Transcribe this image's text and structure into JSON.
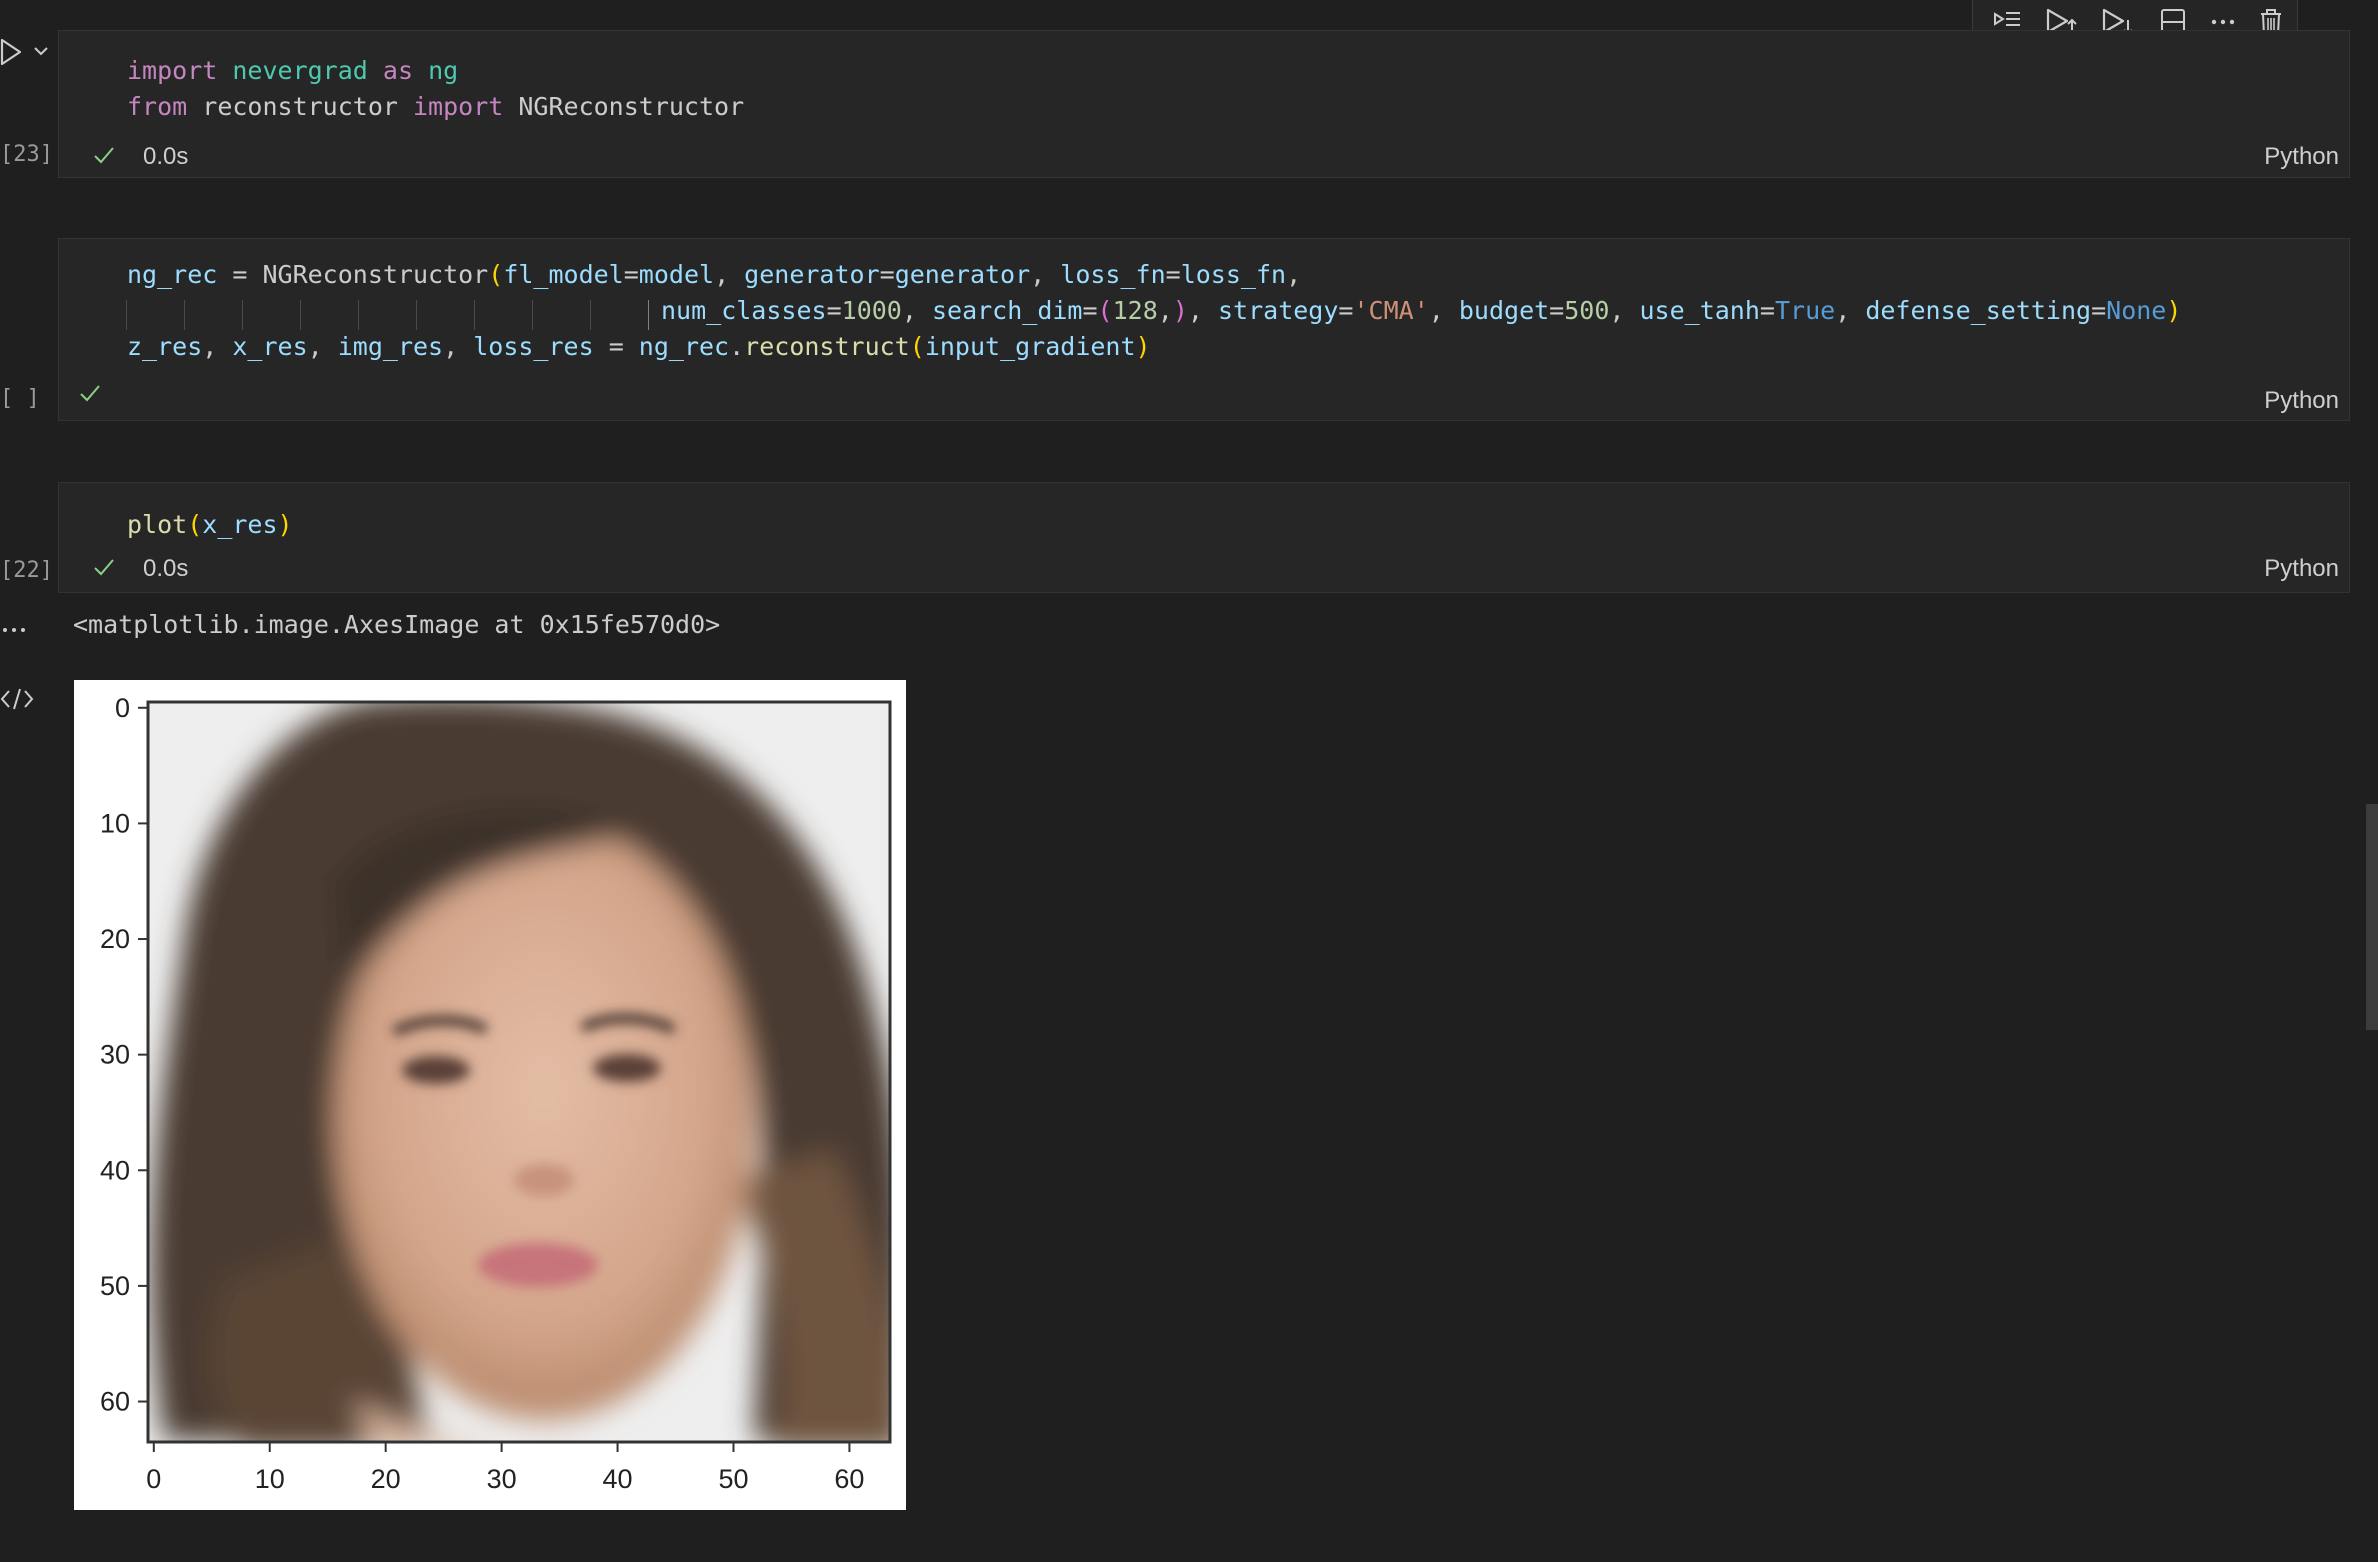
{
  "toolbar": {
    "icons": [
      "run-by-line-icon",
      "execute-above-icon",
      "execute-below-icon",
      "split-cell-icon",
      "more-actions-icon",
      "delete-icon"
    ]
  },
  "cells": [
    {
      "exec_count": "[23]",
      "duration": "0.0s",
      "language": "Python",
      "lines": [
        [
          {
            "t": "import",
            "c": "kw"
          },
          {
            "t": " "
          },
          {
            "t": "nevergrad",
            "c": "mod"
          },
          {
            "t": " "
          },
          {
            "t": "as",
            "c": "kw"
          },
          {
            "t": " "
          },
          {
            "t": "ng",
            "c": "mod"
          }
        ],
        [
          {
            "t": "from",
            "c": "kw"
          },
          {
            "t": " reconstructor "
          },
          {
            "t": "import",
            "c": "kw"
          },
          {
            "t": " NGReconstructor"
          }
        ]
      ]
    },
    {
      "exec_count": "[ ]",
      "duration": "",
      "language": "Python",
      "lines": [
        [
          {
            "t": "ng_rec",
            "c": "var"
          },
          {
            "t": " = NGReconstructor"
          },
          {
            "t": "(",
            "c": "paren"
          },
          {
            "t": "fl_model",
            "c": "var"
          },
          {
            "t": "="
          },
          {
            "t": "model",
            "c": "var"
          },
          {
            "t": ", "
          },
          {
            "t": "generator",
            "c": "var"
          },
          {
            "t": "="
          },
          {
            "t": "generator",
            "c": "var"
          },
          {
            "t": ", "
          },
          {
            "t": "loss_fn",
            "c": "var"
          },
          {
            "t": "="
          },
          {
            "t": "loss_fn",
            "c": "var"
          },
          {
            "t": ","
          }
        ],
        [
          {
            "t": "num_classes",
            "c": "var"
          },
          {
            "t": "="
          },
          {
            "t": "1000",
            "c": "num"
          },
          {
            "t": ", "
          },
          {
            "t": "search_dim",
            "c": "var"
          },
          {
            "t": "="
          },
          {
            "t": "(",
            "c": "paren2"
          },
          {
            "t": "128",
            "c": "num"
          },
          {
            "t": ",",
            "c": ""
          },
          {
            "t": ")",
            "c": "paren2"
          },
          {
            "t": ", "
          },
          {
            "t": "strategy",
            "c": "var"
          },
          {
            "t": "="
          },
          {
            "t": "'CMA'",
            "c": "str"
          },
          {
            "t": ", "
          },
          {
            "t": "budget",
            "c": "var"
          },
          {
            "t": "="
          },
          {
            "t": "500",
            "c": "num"
          },
          {
            "t": ", "
          },
          {
            "t": "use_tanh",
            "c": "var"
          },
          {
            "t": "="
          },
          {
            "t": "True",
            "c": "const"
          },
          {
            "t": ", "
          },
          {
            "t": "defense_setting",
            "c": "var"
          },
          {
            "t": "="
          },
          {
            "t": "None",
            "c": "const"
          },
          {
            "t": ")",
            "c": "paren"
          }
        ],
        [
          {
            "t": "z_res",
            "c": "var"
          },
          {
            "t": ", "
          },
          {
            "t": "x_res",
            "c": "var"
          },
          {
            "t": ", "
          },
          {
            "t": "img_res",
            "c": "var"
          },
          {
            "t": ", "
          },
          {
            "t": "loss_res",
            "c": "var"
          },
          {
            "t": " = "
          },
          {
            "t": "ng_rec",
            "c": "var"
          },
          {
            "t": "."
          },
          {
            "t": "reconstruct",
            "c": "fn"
          },
          {
            "t": "(",
            "c": "paren"
          },
          {
            "t": "input_gradient",
            "c": "var"
          },
          {
            "t": ")",
            "c": "paren"
          }
        ]
      ]
    },
    {
      "exec_count": "[22]",
      "duration": "0.0s",
      "language": "Python",
      "lines": [
        [
          {
            "t": "plot",
            "c": "fn"
          },
          {
            "t": "(",
            "c": "paren"
          },
          {
            "t": "x_res",
            "c": "var"
          },
          {
            "t": ")",
            "c": "paren"
          }
        ]
      ]
    }
  ],
  "output": {
    "text": "<matplotlib.image.AxesImage at 0x15fe570d0>",
    "more_icon": "ellipsis-icon",
    "code_icon": "code-icon",
    "plot": {
      "x_ticks": [
        "0",
        "10",
        "20",
        "30",
        "40",
        "50",
        "60"
      ],
      "y_ticks": [
        "0",
        "10",
        "20",
        "30",
        "40",
        "50",
        "60"
      ]
    }
  }
}
